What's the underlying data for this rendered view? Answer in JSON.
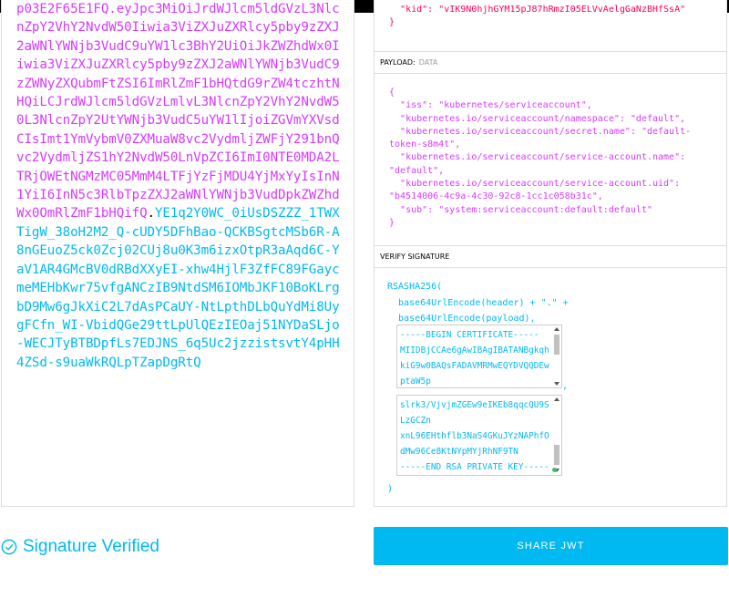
{
  "encoded": {
    "header_tail": "",
    "payload": "p03E2F65E1FQ.eyJpc3MiOiJrdWJlcm5ldGVzL3NlcnZpY2VhY2NvdW50Iiwia3ViZXJuZXRlcy5pby9zZXJ2aWNlYWNjb3VudC9uYW1lc3BhY2UiOiJkZWZhdWx0Iiwia3ViZXJuZXRlcy5pby9zZXJ2aWNlYWNjb3VudC9zZWNyZXQubmFtZSI6ImRlZmF1bHQtdG9rZW4tczhtNHQiLCJrdWJlcm5ldGVzLmlvL3NlcnZpY2VhY2NvdW50L3NlcnZpY2UtYWNjb3VudC5uYW1lIjoiZGVmYXVsdCIsImt1YmVybmV0ZXMuaW8vc2VydmljZWFjY291bnQvc2VydmljZS1hY2NvdW50LnVpZCI6ImI0NTE0MDA2LTRjOWEtNGMzMC05MmM4LTFjYzFjMDU4YjMxYyIsInN1YiI6InN5c3RlbTpzZXJ2aWNlYWNjb3VudDpkZWZhdWx0OmRlZmF1bHQifQ",
    "signature": "YE1q2Y0WC_0iUsDSZZZ_1TWXTigW_38oH2M2_Q-cUDY5DFhBao-QCKBSgtcMSb6R-A8nGEuoZ5ck0Zcj02CUj8u0K3m6izxOtpR3aAqd6C-YaV1AR4GMcBV0dRBdXXyEI-xhw4HjlF3ZfFC89FGaycmeMEHbKwr75vfgANCzIB9NtdSM6IOMbJKF10BoKLrgbD9Mw6gJkXiC2L7dAsPCaUY-NtLpthDLbQuYdMi8UygFCfn_WI-VbidQGe29ttLpUlQEzIEOaj51NYDaSLjo-WECJTyBTBDpfLs7EDJNS_6q5Uc2jzzistsvtY4pHH4ZSd-s9uaWkRQLpTZapDgRtQ"
  },
  "header": {
    "lines": [
      "  \"kid\": \"vIK9N0hjhGYM15pJ87hRmzI05ELVvAelgGaNzBHfSsA\"",
      "}"
    ]
  },
  "payload": {
    "section_label": "PAYLOAD:",
    "section_sub": "DATA",
    "json_text": "{\n  \"iss\": \"kubernetes/serviceaccount\",\n  \"kubernetes.io/serviceaccount/namespace\": \"default\",\n  \"kubernetes.io/serviceaccount/secret.name\": \"default-token-s8m4t\",\n  \"kubernetes.io/serviceaccount/service-account.name\": \"default\",\n  \"kubernetes.io/serviceaccount/service-account.uid\": \"b4514006-4c9a-4c30-92c8-1cc1c058b31c\",\n  \"sub\": \"system:serviceaccount:default:default\"\n}"
  },
  "verify": {
    "section_label": "VERIFY SIGNATURE",
    "line1": "RSASHA256(",
    "line2": "  base64UrlEncode(header) + \".\" +",
    "line3": "  base64UrlEncode(payload),",
    "comma": ",",
    "close": ")",
    "public_key": "-----BEGIN CERTIFICATE-----\nMIIDBjCCAe6gAwIBAgIBATANBgkqh\nkiG9w0BAQsFADAVMRMwEQYDVQQDEw\nptaW5p",
    "private_key": "slrk3/VjvjmZGEw9eIKEb8qqcQU9S\nLzGCZn\nxnL96EHthflb3NaS4GKuJYzNAPhfO\ndMw96Ce8KtNYpMYjRhNF9TN\n-----END RSA PRIVATE KEY-----"
  },
  "status": {
    "verified_text": "Signature Verified"
  },
  "share": {
    "label": "SHARE JWT"
  },
  "colors": {
    "header": "#fb015b",
    "payload": "#d63aff",
    "signature": "#00b9f1"
  }
}
